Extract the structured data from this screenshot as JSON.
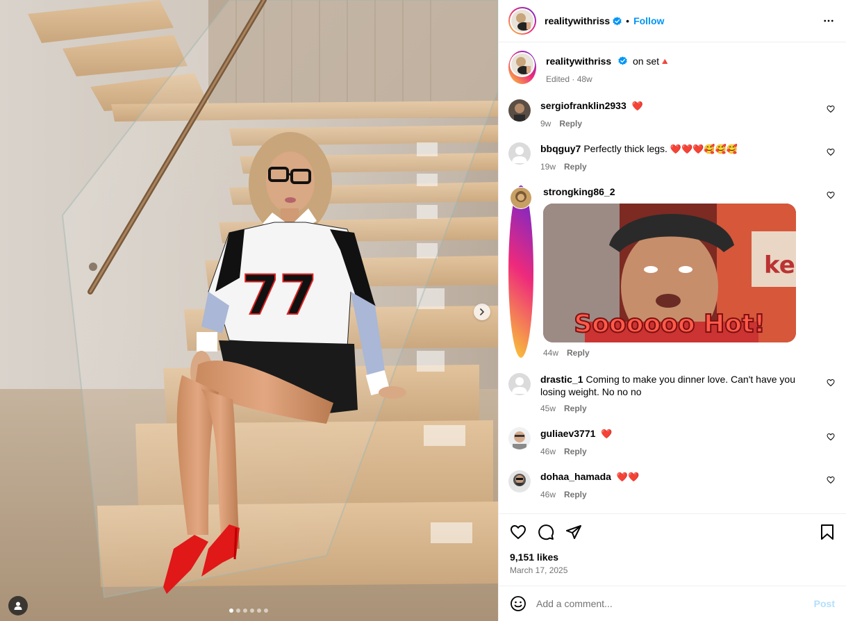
{
  "post": {
    "username": "realitywithriss",
    "follow_label": "Follow",
    "caption": "on set",
    "caption_emoji": "🔺",
    "caption_meta_edited": "Edited",
    "caption_meta_age": "48w",
    "likes": "9,151 likes",
    "date": "March 17, 2025",
    "carousel": {
      "slide_count": 6,
      "active_index": 0
    }
  },
  "comments": [
    {
      "username": "sergiofranklin2933",
      "text": "",
      "emoji": "❤️",
      "age": "9w",
      "reply": "Reply"
    },
    {
      "username": "bbqguy7",
      "text": "Perfectly thick legs.",
      "emoji": "❤️❤️❤️🥰🥰🥰",
      "age": "19w",
      "reply": "Reply"
    },
    {
      "username": "strongking86_2",
      "text": "",
      "emoji": "",
      "gif_caption": "Soooooo Hot!",
      "gif_sign": "ke",
      "age": "44w",
      "reply": "Reply"
    },
    {
      "username": "drastic_1",
      "text": "Coming to make you dinner love. Can't have you losing weight. No no no",
      "emoji": "",
      "age": "45w",
      "reply": "Reply"
    },
    {
      "username": "guliaev3771",
      "text": "",
      "emoji": "❤️",
      "age": "46w",
      "reply": "Reply"
    },
    {
      "username": "dohaa_hamada",
      "text": "",
      "emoji": "❤️❤️",
      "age": "46w",
      "reply": "Reply"
    }
  ],
  "add_comment": {
    "placeholder": "Add a comment...",
    "post_label": "Post"
  },
  "image_text": {
    "jersey_number": "77"
  },
  "colors": {
    "accent": "#0095f6",
    "post_disabled": "#b2dffc",
    "meta": "#737373",
    "heart": "#ed1c24"
  },
  "icons": [
    "verified-badge-icon",
    "more-icon",
    "heart-icon",
    "comment-icon",
    "share-icon",
    "bookmark-icon",
    "emoji-icon",
    "chevron-right-icon",
    "user-tag-icon"
  ]
}
